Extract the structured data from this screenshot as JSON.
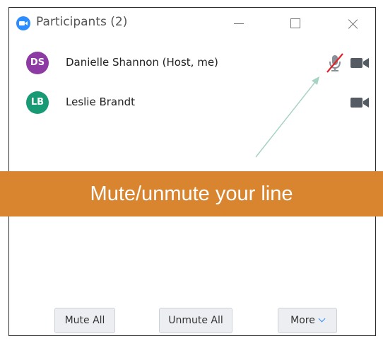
{
  "window": {
    "title": "Participants (2)"
  },
  "participants": [
    {
      "initials": "DS",
      "name": "Danielle Shannon (Host, me)",
      "avatar_color": "#8e3aa5",
      "muted": true
    },
    {
      "initials": "LB",
      "name": "Leslie Brandt",
      "avatar_color": "#189a74",
      "muted": false
    }
  ],
  "annotation": {
    "text": "Mute/unmute your line",
    "color": "#d9852f"
  },
  "footer": {
    "mute_all": "Mute All",
    "unmute_all": "Unmute All",
    "more": "More"
  },
  "icons": {
    "app": "zoom-logo-icon",
    "mic": "microphone-muted-icon",
    "video": "video-camera-icon"
  }
}
